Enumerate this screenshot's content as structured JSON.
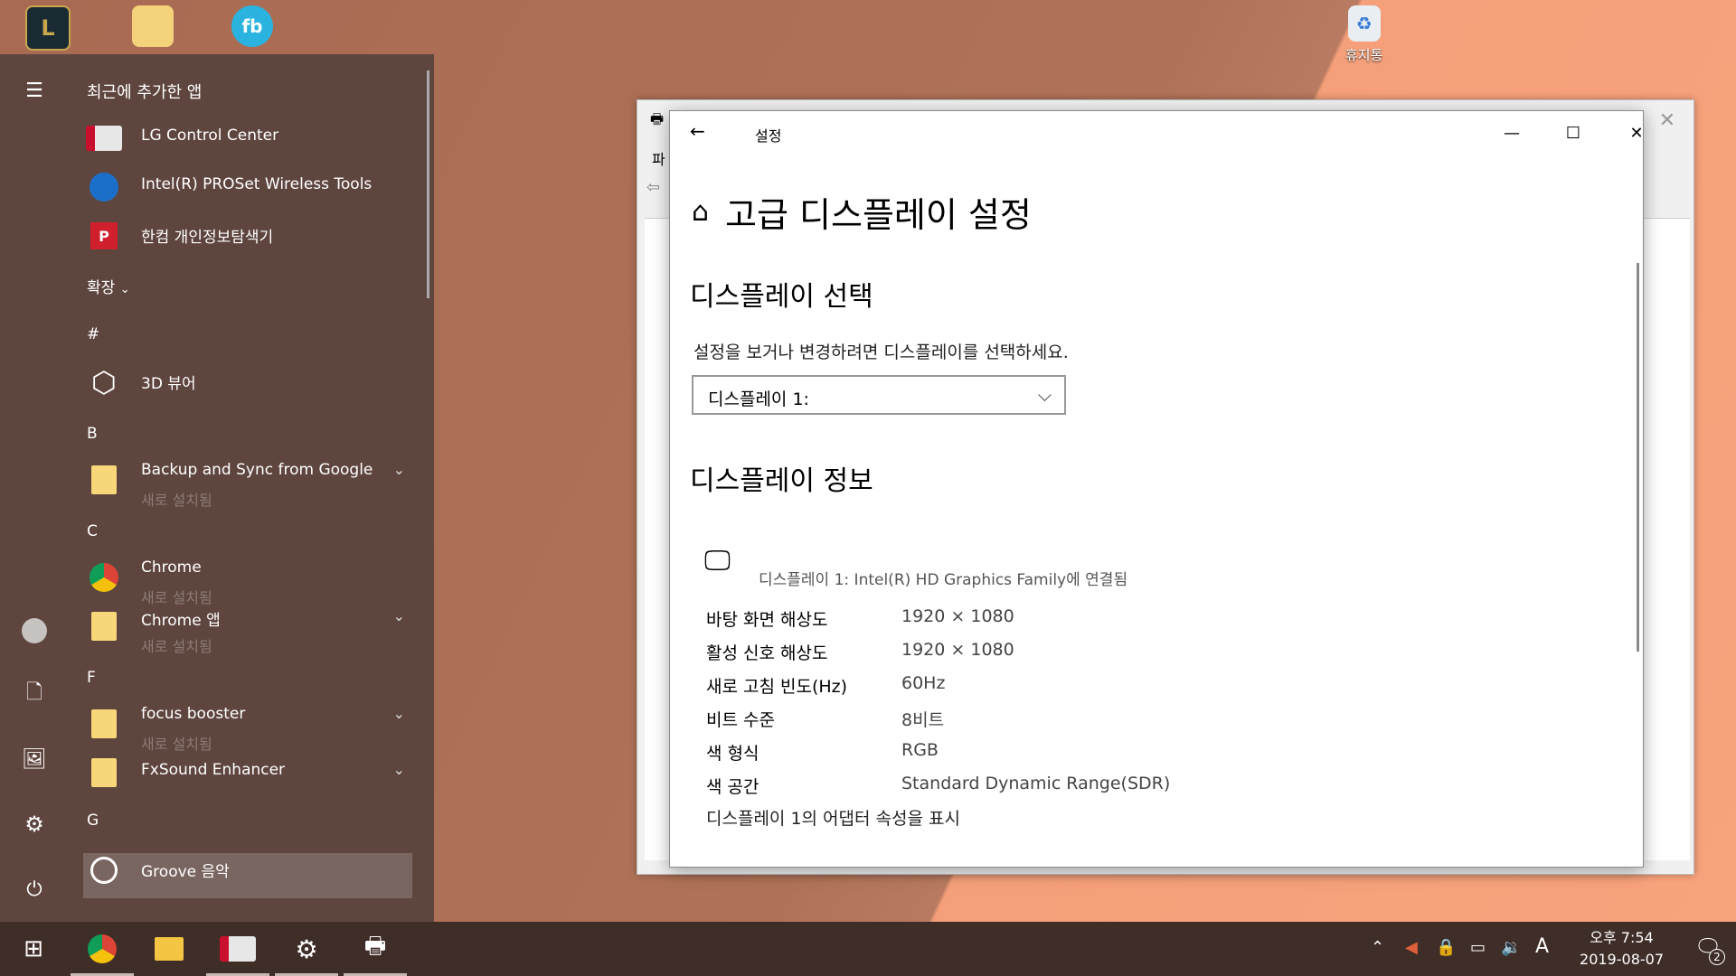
{
  "desktop": {
    "icons": [
      {
        "label": ""
      },
      {
        "label": ""
      },
      {
        "label": ""
      },
      {
        "label": "휴지통"
      }
    ]
  },
  "start_menu": {
    "recently_added_title": "최근에 추가한 앱",
    "recent": [
      {
        "name": "LG Control Center"
      },
      {
        "name": "Intel(R) PROSet Wireless Tools"
      },
      {
        "name": "한컴 개인정보탐색기"
      }
    ],
    "expand_label": "확장",
    "letters": [
      "#",
      "B",
      "C",
      "F",
      "G"
    ],
    "apps": {
      "viewer3d": {
        "name": "3D 뷰어"
      },
      "backup": {
        "name": "Backup and Sync from Google",
        "sub": "새로 설치됨"
      },
      "chrome": {
        "name": "Chrome",
        "sub": "새로 설치됨"
      },
      "chrome_apps": {
        "name": "Chrome 앱",
        "sub": "새로 설치됨"
      },
      "focus": {
        "name": "focus booster",
        "sub": "새로 설치됨"
      },
      "fxsound": {
        "name": "FxSound Enhancer"
      },
      "groove": {
        "name": "Groove 음악"
      }
    }
  },
  "settings": {
    "window_title": "설정",
    "page_title": "고급 디스플레이 설정",
    "select_heading": "디스플레이 선택",
    "select_desc": "설정을 보거나 변경하려면 디스플레이를 선택하세요.",
    "dropdown_value": "디스플레이 1:",
    "info_heading": "디스플레이 정보",
    "connected_text": "디스플레이 1: Intel(R) HD Graphics Family에 연결됨",
    "info": [
      {
        "label": "바탕 화면 해상도",
        "value": "1920 × 1080"
      },
      {
        "label": "활성 신호 해상도",
        "value": "1920 × 1080"
      },
      {
        "label": "새로 고침 빈도(Hz)",
        "value": "60Hz"
      },
      {
        "label": "비트 수준",
        "value": "8비트"
      },
      {
        "label": "색 형식",
        "value": "RGB"
      },
      {
        "label": "색 공간",
        "value": "Standard Dynamic Range(SDR)"
      }
    ],
    "adapter_link": "디스플레이 1의 어댑터 속성을 표시"
  },
  "bg_window": {
    "menu_fragment": "파"
  },
  "taskbar": {
    "ime": "A",
    "time": "오후 7:54",
    "date": "2019-08-07",
    "notification_count": "2"
  }
}
